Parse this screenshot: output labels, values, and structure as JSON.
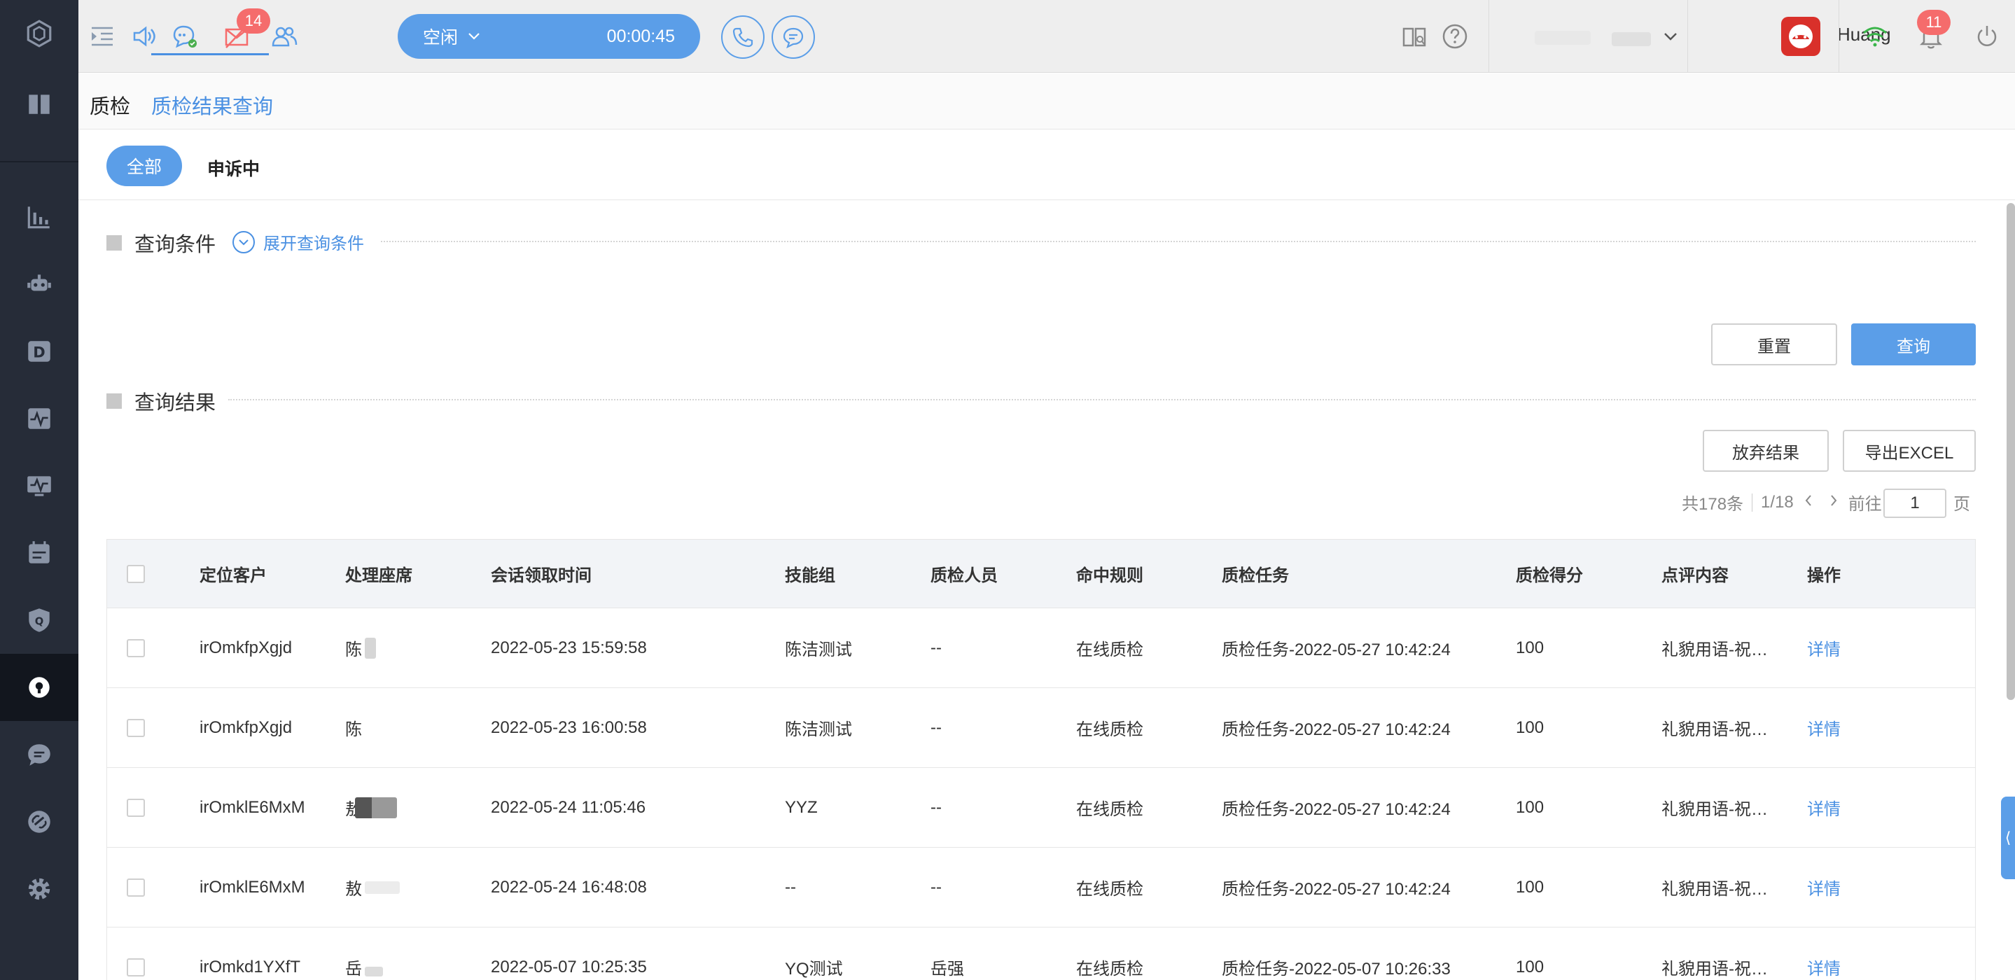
{
  "colors": {
    "accent": "#5b9ee8",
    "sidebar": "#262c38",
    "badge": "#f56c6c"
  },
  "topbar": {
    "message_badge": "14",
    "status_label": "空闲",
    "timer": "00:00:45",
    "user_name": "Huang",
    "notification_badge": "11"
  },
  "tabs": [
    {
      "label": "质检"
    },
    {
      "label": "质检结果查询"
    }
  ],
  "filters": {
    "all": "全部",
    "appeal": "申诉中"
  },
  "query": {
    "section_title": "查询条件",
    "expand_label": "展开查询条件",
    "reset_label": "重置",
    "search_label": "查询"
  },
  "results": {
    "section_title": "查询结果",
    "discard_label": "放弃结果",
    "export_label": "导出EXCEL",
    "total_text": "共178条",
    "page_text": "1/18",
    "goto_label": "前往",
    "page_input": "1",
    "page_suffix": "页"
  },
  "table": {
    "headers": [
      "定位客户",
      "处理座席",
      "会话领取时间",
      "技能组",
      "质检人员",
      "命中规则",
      "质检任务",
      "质检得分",
      "点评内容",
      "操作"
    ],
    "rows": [
      {
        "customer": "irOmkfpXgjd",
        "agent": "陈",
        "time": "2022-05-23 15:59:58",
        "group": "陈洁测试",
        "inspector": "--",
        "rule": "在线质检",
        "task": "质检任务-2022-05-27 10:42:24",
        "score": "100",
        "comment": "礼貌用语-祝…",
        "action": "详情"
      },
      {
        "customer": "irOmkfpXgjd",
        "agent": "陈",
        "time": "2022-05-23 16:00:58",
        "group": "陈洁测试",
        "inspector": "--",
        "rule": "在线质检",
        "task": "质检任务-2022-05-27 10:42:24",
        "score": "100",
        "comment": "礼貌用语-祝…",
        "action": "详情"
      },
      {
        "customer": "irOmklE6MxM",
        "agent": "敖",
        "time": "2022-05-24 11:05:46",
        "group": "YYZ",
        "inspector": "--",
        "rule": "在线质检",
        "task": "质检任务-2022-05-27 10:42:24",
        "score": "100",
        "comment": "礼貌用语-祝…",
        "action": "详情"
      },
      {
        "customer": "irOmklE6MxM",
        "agent": "敖",
        "time": "2022-05-24 16:48:08",
        "group": "--",
        "inspector": "--",
        "rule": "在线质检",
        "task": "质检任务-2022-05-27 10:42:24",
        "score": "100",
        "comment": "礼貌用语-祝…",
        "action": "详情"
      },
      {
        "customer": "irOmkd1YXfT",
        "agent": "岳",
        "time": "2022-05-07 10:25:35",
        "group": "YQ测试",
        "inspector": "岳强",
        "rule": "在线质检",
        "task": "质检任务-2022-05-07 10:26:33",
        "score": "100",
        "comment": "礼貌用语-祝…",
        "action": "详情"
      }
    ]
  },
  "side_tab_glyph": "⟨"
}
